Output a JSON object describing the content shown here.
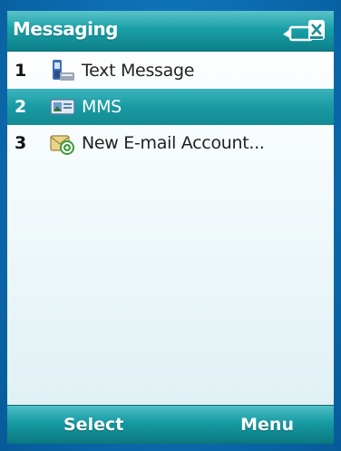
{
  "titlebar": {
    "title": "Messaging",
    "status_icon": "connectivity-icon"
  },
  "list": {
    "items": [
      {
        "number": "1",
        "label": "Text Message",
        "icon": "text-message-icon",
        "selected": false
      },
      {
        "number": "2",
        "label": "MMS",
        "icon": "mms-icon",
        "selected": true
      },
      {
        "number": "3",
        "label": "New E-mail Account...",
        "icon": "email-account-icon",
        "selected": false
      }
    ]
  },
  "softkeys": {
    "left": "Select",
    "right": "Menu"
  },
  "colors": {
    "accent": "#1aa0a8",
    "frame": "#0a6fb3"
  }
}
